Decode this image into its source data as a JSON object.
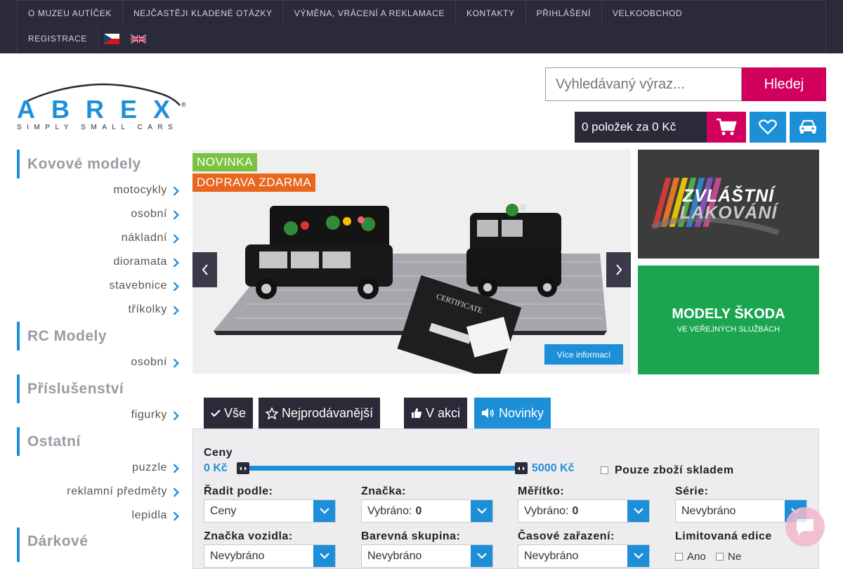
{
  "topnav": {
    "row1": [
      "O MUZEU AUTÍČEK",
      "NEJČASTĚJI KLADENÉ OTÁZKY",
      "VÝMĚNA, VRÁCENÍ A REKLAMACE",
      "KONTAKTY",
      "PŘIHLÁŠENÍ",
      "VELKOOBCHOD"
    ],
    "row2": [
      "REGISTRACE"
    ],
    "flags": [
      "czech-flag-icon",
      "uk-flag-icon"
    ]
  },
  "logo": {
    "brand": "ABREX",
    "tagline": "SIMPLY SMALL CARS"
  },
  "search": {
    "placeholder": "Vyhledávaný výraz...",
    "button": "Hledej"
  },
  "cart": {
    "summary": "0 položek za 0 Kč",
    "icon": "cart-icon"
  },
  "header_icons": {
    "wishlist": "heart-icon",
    "garage": "car-icon"
  },
  "sidebar": {
    "cat1": {
      "title": "Kovové modely",
      "items": [
        "motocykly",
        "osobní",
        "nákladní",
        "dioramata",
        "stavebnice",
        "tříkolky"
      ]
    },
    "cat2": {
      "title": "RC Modely",
      "items": [
        "osobní"
      ]
    },
    "cat3": {
      "title": "Příslušenství",
      "items": [
        "figurky"
      ]
    },
    "cat4": {
      "title": "Ostatní",
      "items": [
        "puzzle",
        "reklamní předměty",
        "lepidla"
      ]
    },
    "cat5": {
      "title": "Dárkové"
    }
  },
  "banner": {
    "badge_new": "NOVINKA",
    "badge_ship": "DOPRAVA ZDARMA",
    "more_info": "Více informací",
    "certificate_text": "CERTIFICATE"
  },
  "promos": {
    "promo1_line1": "ZVLÁŠTNÍ",
    "promo1_line2": "LAKOVÁNÍ",
    "promo2_line1": "MODELY ŠKODA",
    "promo2_line2": "VE VEŘEJNÝCH SLUŽBÁCH"
  },
  "tabs": {
    "all": "Vše",
    "best": "Nejprodávanější",
    "sale": "V akci",
    "new": "Novinky"
  },
  "filter": {
    "price_label": "Ceny",
    "price_min": "0 Kč",
    "price_max": "5000 Kč",
    "stock_only": "Pouze zboží skladem",
    "sort_label": "Řadit podle:",
    "sort_value": "Ceny",
    "brand_label": "Značka:",
    "brand_prefix": "Vybráno:",
    "brand_count": "0",
    "scale_label": "Měřítko:",
    "scale_prefix": "Vybráno:",
    "scale_count": "0",
    "series_label": "Série:",
    "series_value": "Nevybráno",
    "car_brand_label": "Značka vozidla:",
    "car_brand_value": "Nevybráno",
    "color_label": "Barevná skupina:",
    "color_value": "Nevybráno",
    "era_label": "Časové zařazení:",
    "era_value": "Nevybráno",
    "limited_label": "Limitovaná edice",
    "limited_yes": "Ano",
    "limited_no": "Ne"
  },
  "colors": {
    "magenta": "#d1005d",
    "blue": "#1d8fd8",
    "dark": "#2a2a38",
    "green": "#7cc242",
    "orange": "#e8661d"
  }
}
